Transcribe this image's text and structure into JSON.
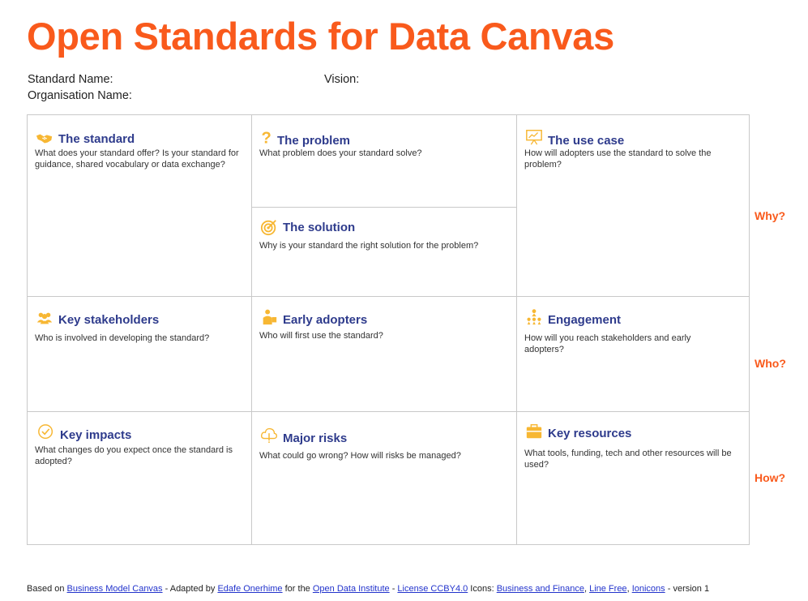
{
  "title": "Open Standards for Data Canvas",
  "meta": {
    "standard_name": "Standard Name:",
    "organisation_name": "Organisation Name:",
    "vision": "Vision:"
  },
  "cells": {
    "standard": {
      "title": "The standard",
      "desc": "What does your standard offer? Is your standard for guidance, shared vocabulary or data exchange?",
      "icon": "handshake-icon"
    },
    "problem": {
      "title": "The problem",
      "desc": "What problem does your standard solve?",
      "icon": "question-mark-icon"
    },
    "use_case": {
      "title": "The use case",
      "desc": "How will adopters use the standard to solve the problem?",
      "icon": "presentation-board-icon"
    },
    "solution": {
      "title": "The solution",
      "desc": "Why is your standard the right solution for the problem?",
      "icon": "target-icon"
    },
    "stakeholders": {
      "title": "Key stakeholders",
      "desc": "Who is involved in developing the standard?",
      "icon": "people-group-icon"
    },
    "adopters": {
      "title": "Early adopters",
      "desc": "Who will first use the standard?",
      "icon": "person-presenting-icon"
    },
    "engagement": {
      "title": "Engagement",
      "desc": "How will you reach stakeholders and early adopters?",
      "icon": "network-hierarchy-icon"
    },
    "impacts": {
      "title": "Key impacts",
      "desc": "What changes do you expect once the standard is adopted?",
      "icon": "check-circle-icon"
    },
    "risks": {
      "title": "Major risks",
      "desc": "What could go wrong? How will risks be managed?",
      "icon": "cloud-warning-icon"
    },
    "resources": {
      "title": "Key resources",
      "desc": "What tools, funding, tech and other resources  will be used?",
      "icon": "briefcase-icon"
    }
  },
  "side_labels": {
    "why": "Why?",
    "who": "Who?",
    "how": "How?"
  },
  "footer": {
    "t1": "Based on ",
    "l1": "Business Model Canvas",
    "t2": " - Adapted by ",
    "l2": "Edafe Onerhime",
    "t3": " for the ",
    "l3": "Open Data Institute",
    "t4": " - ",
    "l4": "License CCBY4.0",
    "t5": " Icons: ",
    "l5": "Business and Finance",
    "t6": ", ",
    "l6": "Line Free",
    "t7": ", ",
    "l7": "Ionicons",
    "t8": " - version 1"
  },
  "colors": {
    "accent": "#f95a1c",
    "heading": "#2e3b8c",
    "icon": "#f7b733",
    "border": "#c9c9c9",
    "link": "#2233cc"
  }
}
